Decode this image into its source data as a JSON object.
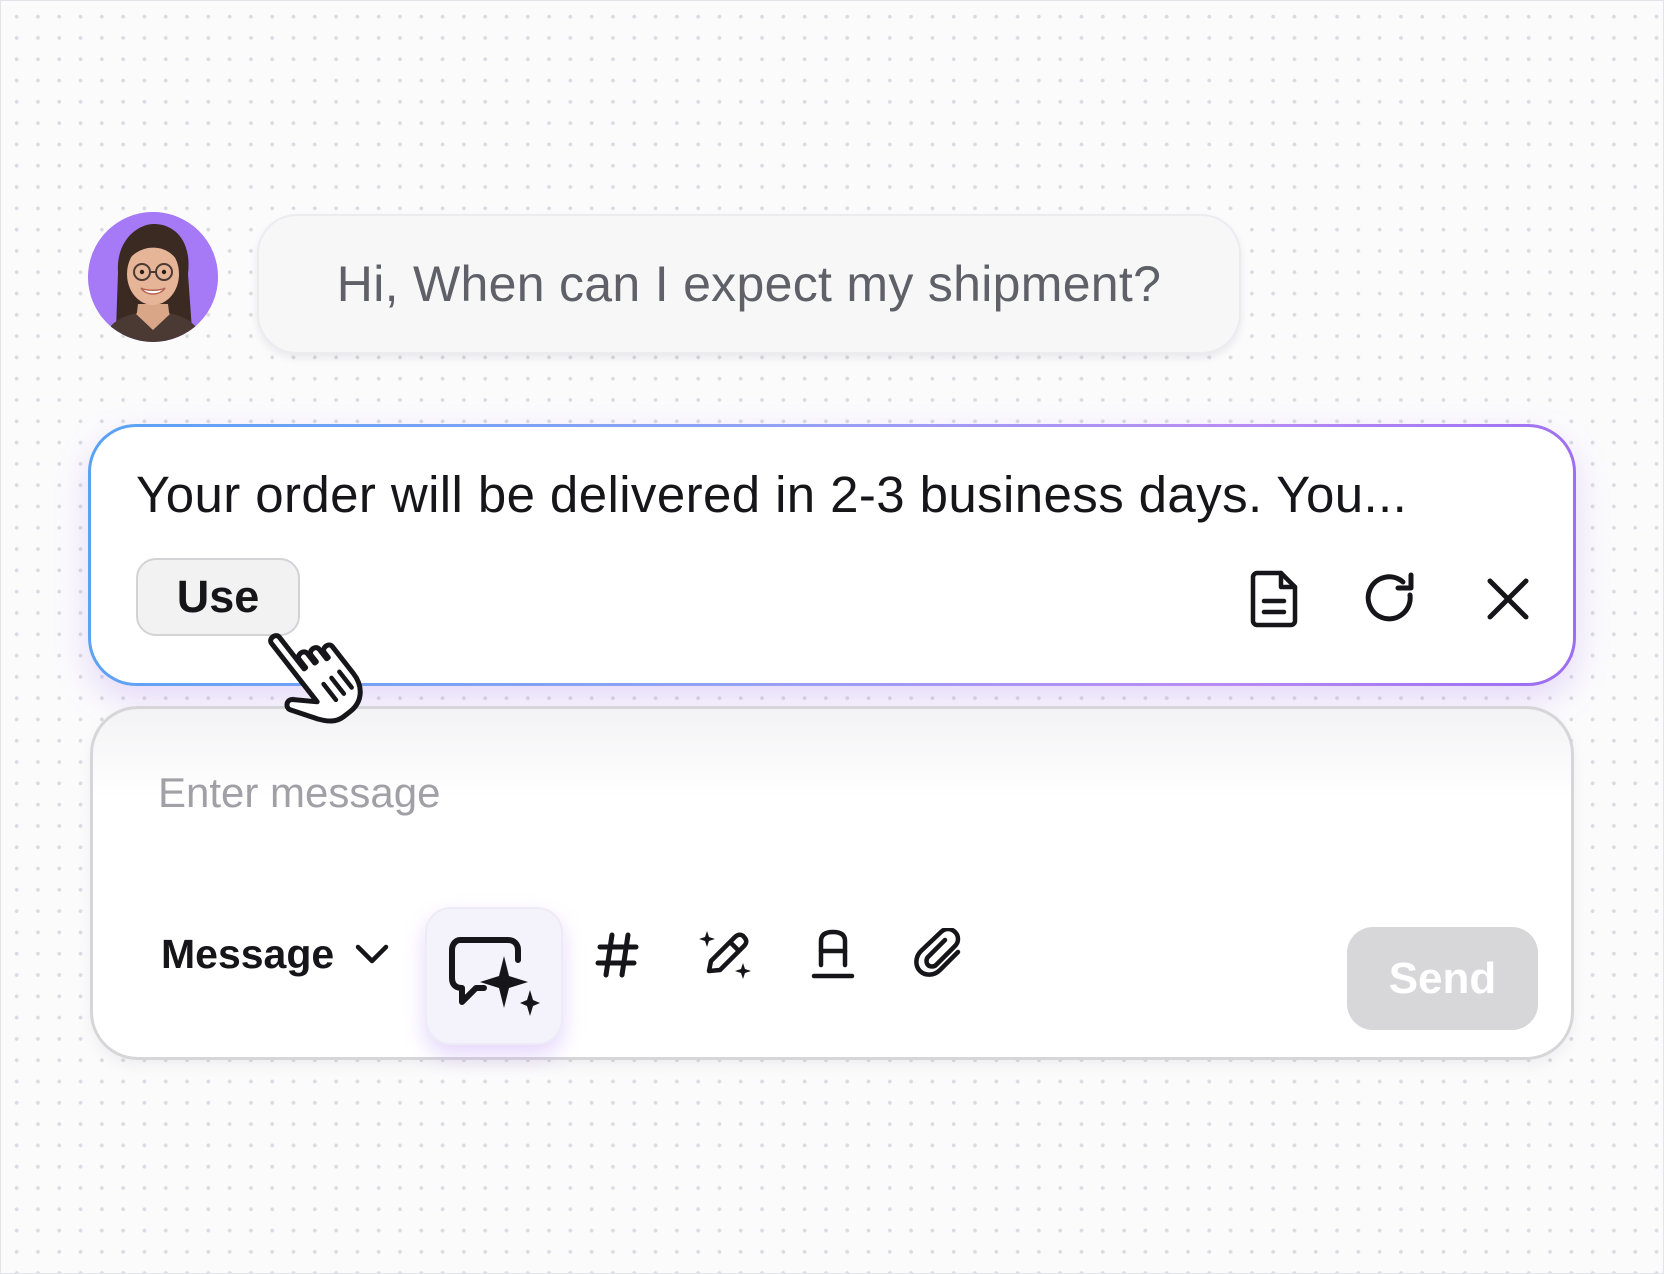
{
  "conversation": {
    "incoming_message": "Hi, When can I expect my shipment?"
  },
  "suggestion": {
    "text": "Your order will be delivered in 2-3 business days. You...",
    "use_label": "Use",
    "actions": [
      "document-icon",
      "regenerate-icon",
      "close-icon"
    ]
  },
  "composer": {
    "placeholder": "Enter message",
    "message_type": "Message",
    "tools": [
      "ai-reply-icon",
      "hashtag-icon",
      "magic-pen-icon",
      "text-format-icon",
      "attachment-icon"
    ],
    "send_label": "Send"
  },
  "colors": {
    "avatar_background": "#a67af7",
    "suggestion_border_start": "#5aa2f4",
    "suggestion_border_end": "#9b6df0",
    "send_disabled": "#d7d7d9"
  }
}
